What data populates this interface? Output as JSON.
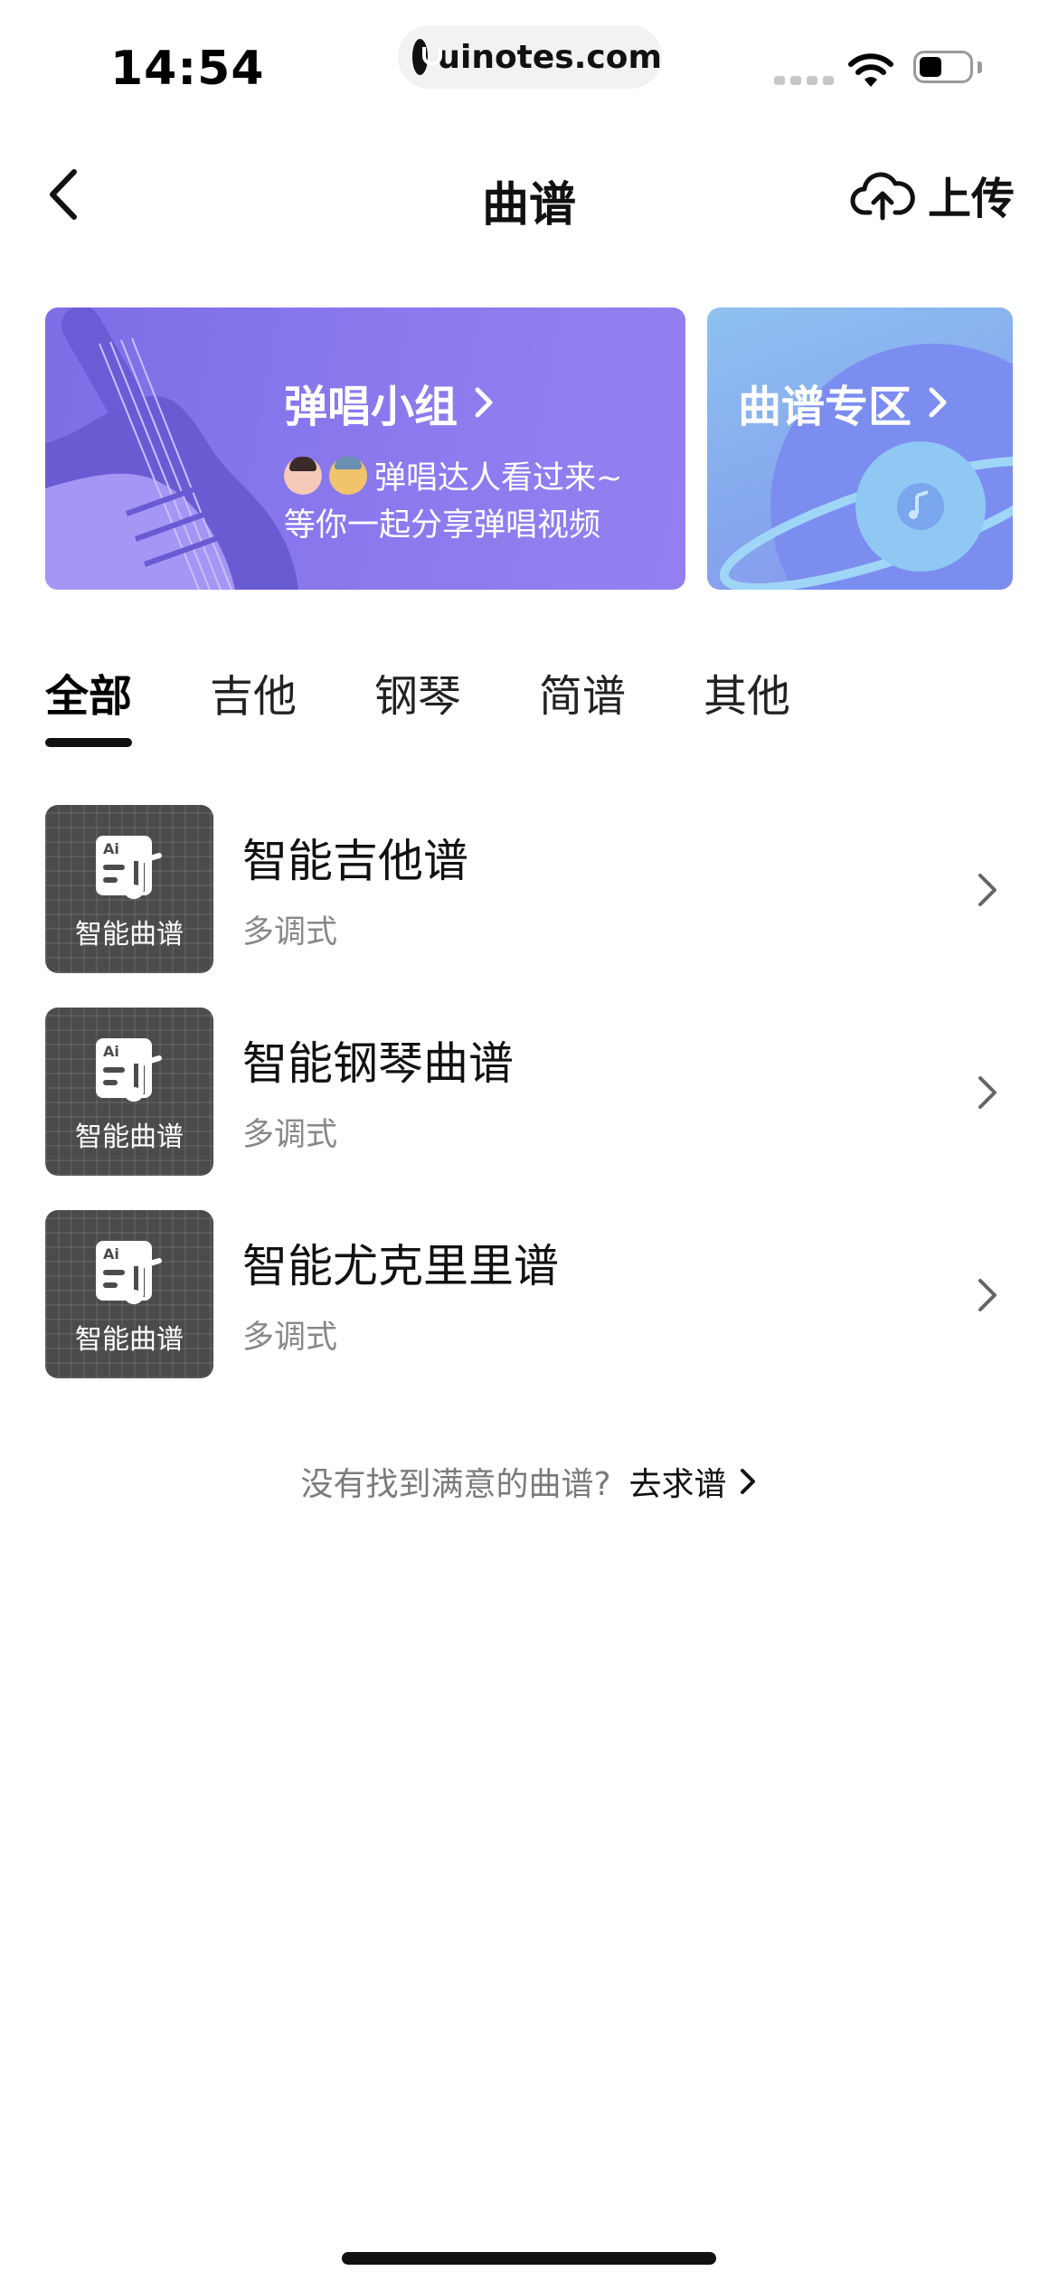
{
  "status_bar": {
    "time": "14:54",
    "url": "uinotes.com"
  },
  "nav": {
    "title": "曲谱",
    "upload_label": "上传",
    "back_icon": "chevron-left-icon",
    "upload_icon": "cloud-upload-icon"
  },
  "banners": [
    {
      "title": "弹唱小组",
      "line1": "弹唱达人看过来~",
      "line2": "等你一起分享弹唱视频",
      "color": "#8a78ec"
    },
    {
      "title": "曲谱专区",
      "color": "#8aa8ee"
    }
  ],
  "tabs": [
    "全部",
    "吉他",
    "钢琴",
    "简谱",
    "其他"
  ],
  "active_tab": "全部",
  "items": [
    {
      "thumb_label": "智能曲谱",
      "title": "智能吉他谱",
      "subtitle": "多调式"
    },
    {
      "thumb_label": "智能曲谱",
      "title": "智能钢琴曲谱",
      "subtitle": "多调式"
    },
    {
      "thumb_label": "智能曲谱",
      "title": "智能尤克里里谱",
      "subtitle": "多调式"
    }
  ],
  "footer": {
    "question": "没有找到满意的曲谱?",
    "link": "去求谱"
  },
  "colors": {
    "banner_purple": "#8a78ec",
    "banner_blue": "#8aa8ee",
    "thumb_bg": "#4b4b4b",
    "subtitle_gray": "#888888"
  }
}
